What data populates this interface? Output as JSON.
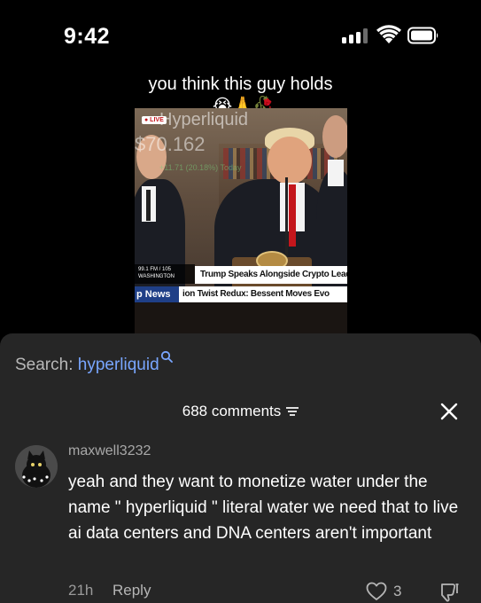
{
  "status_bar": {
    "time": "9:42",
    "signal_bars_filled": 3,
    "signal_bars_total": 4
  },
  "video": {
    "caption": "you think this guy holds",
    "caption_emojis": "😭🙏🥀",
    "overlay_ticker": "Hyperliquid",
    "overlay_price": "$70.162",
    "overlay_change": "+11.71 (20.18%) Today",
    "live_badge": "● LIVE",
    "radio_line1": "99.1 FM / 105",
    "radio_line2": "WASHINGTON",
    "headline": "Trump Speaks Alongside Crypto Leade",
    "news_label": "p News",
    "news_ticker": "ion Twist Redux: Bessent Moves Evo"
  },
  "search": {
    "prefix": "Search: ",
    "term": "hyperliquid",
    "icon": "search-icon"
  },
  "comments_header": {
    "label": "688 comments",
    "filter_icon": "filter-icon",
    "close_icon": "close-icon"
  },
  "comment": {
    "username": "maxwell3232",
    "text": "yeah and they want to monetize water under the name \" hyperliquid \" literal water we need that to live ai data centers and DNA centers aren't important",
    "timestamp": "21h",
    "reply_label": "Reply",
    "like_count": "3"
  },
  "colors": {
    "sheet_background": "#262626",
    "search_term": "#79a6ff",
    "news_blue": "#1f3f87"
  }
}
